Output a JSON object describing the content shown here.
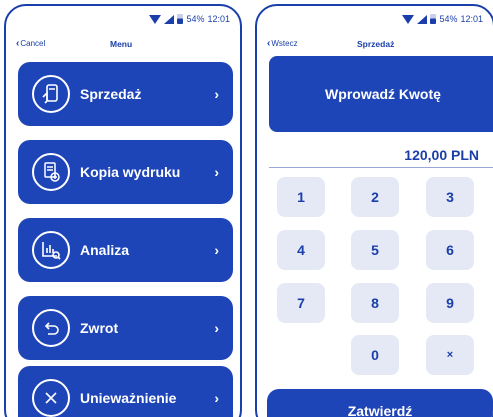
{
  "status": {
    "battery": "54%",
    "time": "12:01"
  },
  "menu_screen": {
    "back_label": "Cancel",
    "title": "Menu",
    "items": [
      {
        "label": "Sprzedaż",
        "icon": "phone-payment-icon"
      },
      {
        "label": "Kopia wydruku",
        "icon": "receipt-copy-icon"
      },
      {
        "label": "Analiza",
        "icon": "analytics-icon"
      },
      {
        "label": "Zwrot",
        "icon": "return-arrow-icon"
      },
      {
        "label": "Unieważnienie",
        "icon": "cancel-x-icon"
      }
    ],
    "arrow": "›"
  },
  "sale_screen": {
    "back_label": "Wstecz",
    "title": "Sprzedaż",
    "header": "Wprowadź Kwotę",
    "amount": "120,00 PLN",
    "keys": [
      "1",
      "2",
      "3",
      "4",
      "5",
      "6",
      "7",
      "8",
      "9",
      "0",
      "×"
    ],
    "confirm_label": "Zatwierdź"
  },
  "colors": {
    "primary": "#1e45b8",
    "key_bg": "#e4e9f5",
    "text_primary": "#1a3faa"
  }
}
